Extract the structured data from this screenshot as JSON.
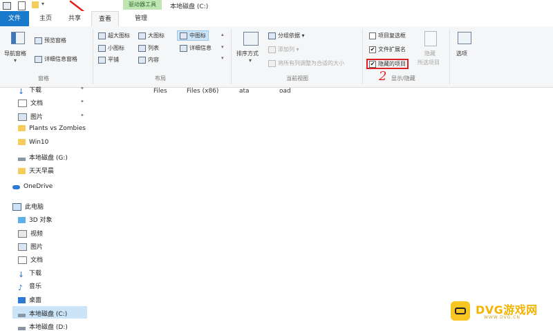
{
  "window": {
    "title": "本地磁盘 (C:)",
    "drive_tools_tab": "驱动器工具"
  },
  "tabs": [
    "文件",
    "主页",
    "共享",
    "查看",
    "管理"
  ],
  "ribbon": {
    "pane": {
      "nav_pane": "导航窗格",
      "preview_pane": "预览窗格",
      "details_pane": "详细信息窗格",
      "group": "窗格"
    },
    "layout": {
      "items": [
        "超大图标",
        "大图标",
        "中图标",
        "小图标",
        "列表",
        "详细信息",
        "平铺",
        "内容"
      ],
      "group": "布局"
    },
    "current_view": {
      "sort": "排序方式",
      "group_by": "分组依据",
      "add_column": "添加列",
      "fit_columns": "将所有列调整为合适的大小",
      "group": "当前视图"
    },
    "show_hide": {
      "item_checkboxes": "项目复选框",
      "file_extensions": "文件扩展名",
      "hidden_items": "隐藏的项目",
      "hide": "隐藏",
      "selected_items": "所选项目",
      "group": "显示/隐藏"
    },
    "options": "选项"
  },
  "content_columns": [
    "Files",
    "Files (x86)",
    "ata",
    "oad"
  ],
  "nav": {
    "quick_access": [
      "下载",
      "文档",
      "图片",
      "Plants vs Zombies",
      "Win10",
      "本地磁盘 (G:)",
      "天天早晨"
    ],
    "onedrive": "OneDrive",
    "this_pc": "此电脑",
    "pc_items": [
      "3D 对象",
      "视频",
      "图片",
      "文档",
      "下载",
      "音乐",
      "桌面",
      "本地磁盘 (C:)",
      "本地磁盘 (D:)"
    ]
  },
  "annotation": {
    "number": "2"
  },
  "watermark": {
    "brand": "DVG游戏网",
    "url": "WWW.DVG.CN"
  },
  "colors": {
    "file_tab": "#1979ca",
    "drive_tools": "#bfe6b2",
    "annotation": "#e02020",
    "folder": "#f5cd5c",
    "selected": "#cce4f7"
  }
}
